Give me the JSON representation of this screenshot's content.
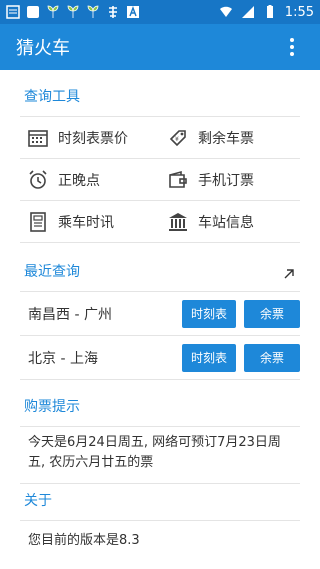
{
  "status_bar": {
    "time": "1:55",
    "icons": [
      "notification-icon",
      "square-icon",
      "plant-icon",
      "plant-icon",
      "plant-icon",
      "app-icon",
      "a-icon",
      "wifi-icon",
      "signal-icon",
      "battery-icon"
    ]
  },
  "app_bar": {
    "title": "猜火车"
  },
  "query_tools": {
    "header": "查询工具",
    "items": [
      {
        "label": "时刻表票价",
        "icon": "calendar-icon"
      },
      {
        "label": "剩余车票",
        "icon": "ticket-icon"
      },
      {
        "label": "正晚点",
        "icon": "alarm-clock-icon"
      },
      {
        "label": "手机订票",
        "icon": "wallet-icon"
      },
      {
        "label": "乘车时讯",
        "icon": "news-icon"
      },
      {
        "label": "车站信息",
        "icon": "station-icon"
      }
    ]
  },
  "recent": {
    "header": "最近查询",
    "rows": [
      {
        "route": "南昌西 - 广州",
        "timetable_label": "时刻表",
        "tickets_label": "余票"
      },
      {
        "route": "北京 - 上海",
        "timetable_label": "时刻表",
        "tickets_label": "余票"
      }
    ]
  },
  "tips": {
    "header": "购票提示",
    "text": "今天是6月24日周五, 网络可预订7月23日周五, 农历六月廿五的票"
  },
  "about": {
    "header": "关于",
    "text": "您目前的版本是8.3"
  }
}
